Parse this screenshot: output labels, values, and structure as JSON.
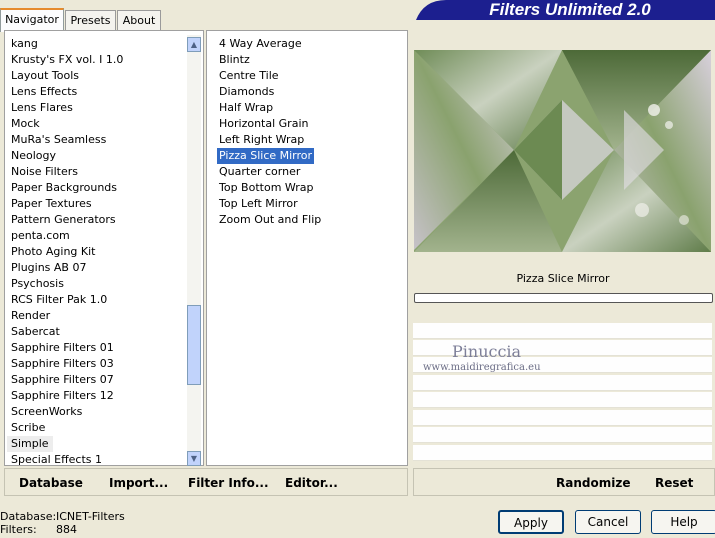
{
  "tabs": [
    "Navigator",
    "Presets",
    "About"
  ],
  "title": "Filters Unlimited 2.0",
  "categories": [
    "kang",
    "Krusty's FX vol. I 1.0",
    "Layout Tools",
    "Lens Effects",
    "Lens Flares",
    "Mock",
    "MuRa's Seamless",
    "Neology",
    "Noise Filters",
    "Paper Backgrounds",
    "Paper Textures",
    "Pattern Generators",
    "penta.com",
    "Photo Aging Kit",
    "Plugins AB 07",
    "Psychosis",
    "RCS Filter Pak 1.0",
    "Render",
    "Sabercat",
    "Sapphire Filters 01",
    "Sapphire Filters 03",
    "Sapphire Filters 07",
    "Sapphire Filters 12",
    "ScreenWorks",
    "Scribe",
    "Simple",
    "Special Effects 1"
  ],
  "filters": [
    "4 Way Average",
    "Blintz",
    "Centre Tile",
    "Diamonds",
    "Half Wrap",
    "Horizontal Grain",
    "Left Right Wrap",
    "Pizza Slice Mirror",
    "Quarter corner",
    "Top Bottom Wrap",
    "Top Left Mirror",
    "Zoom Out and Flip"
  ],
  "selected_category": "Simple",
  "selected_filter": "Pizza Slice Mirror",
  "preview": {
    "filter_name": "Pizza Slice Mirror"
  },
  "watermark": {
    "name": "Pinuccia",
    "url": "www.maidiregrafica.eu"
  },
  "commands": {
    "database": "Database",
    "import": "Import...",
    "filter_info": "Filter Info...",
    "editor": "Editor...",
    "randomize": "Randomize",
    "reset": "Reset"
  },
  "status": {
    "database_label": "Database:",
    "database_value": "ICNET-Filters",
    "filters_label": "Filters:",
    "filters_value": "884"
  },
  "buttons": {
    "apply": "Apply",
    "cancel": "Cancel",
    "help": "Help"
  },
  "colors": {
    "banner": "#1c1f8f",
    "selection": "#316ac5",
    "tab_accent": "#e68b2c"
  }
}
